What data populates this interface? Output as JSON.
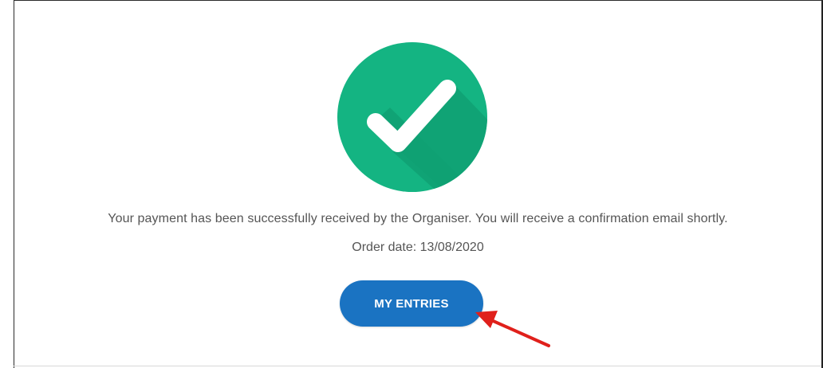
{
  "confirmation": {
    "icon": "success-checkmark-icon",
    "message": "Your payment has been successfully received by the Organiser. You will receive a confirmation email shortly.",
    "order_date_label": "Order date: 13/08/2020"
  },
  "actions": {
    "my_entries_label": "MY ENTRIES"
  },
  "annotation": {
    "icon": "red-arrow-icon"
  },
  "colors": {
    "success_green": "#14b482",
    "success_green_shadow": "#109a6e",
    "button_blue": "#1a73c2",
    "arrow_red": "#e0201b"
  }
}
